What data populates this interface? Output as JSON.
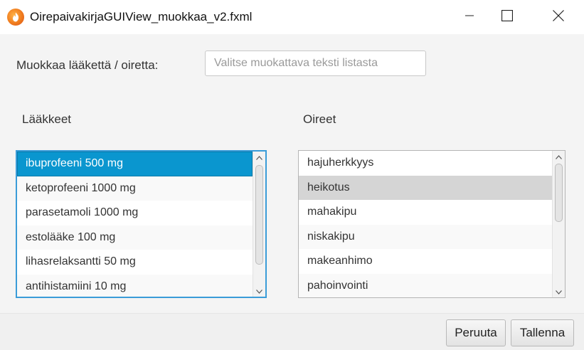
{
  "window": {
    "title": "OirepaivakirjaGUIView_muokkaa_v2.fxml",
    "app_icon": "flame-app-icon",
    "controls": [
      "minimize-icon",
      "maximize-icon",
      "close-icon"
    ]
  },
  "edit": {
    "label": "Muokkaa lääkettä / oiretta:",
    "value": "",
    "placeholder": "Valitse muokattava teksti listasta"
  },
  "medicines": {
    "heading": "Lääkkeet",
    "items": [
      "ibuprofeeni 500 mg",
      "ketoprofeeni 1000 mg",
      "parasetamoli 1000 mg",
      "estolääke 100 mg",
      "lihasrelaksantti 50 mg",
      "antihistamiini 10 mg"
    ],
    "selected": "ibuprofeeni 500 mg"
  },
  "symptoms": {
    "heading": "Oireet",
    "items": [
      "hajuherkkyys",
      "heikotus",
      "mahakipu",
      "niskakipu",
      "makeanhimo",
      "pahoinvointi"
    ],
    "hovered": "heikotus"
  },
  "buttons": {
    "cancel": "Peruuta",
    "save": "Tallenna"
  },
  "colors": {
    "selection": "#0a96cf",
    "focus_border": "#3a9cd8",
    "hover_row": "#d5d5d5",
    "background": "#f4f4f4"
  }
}
